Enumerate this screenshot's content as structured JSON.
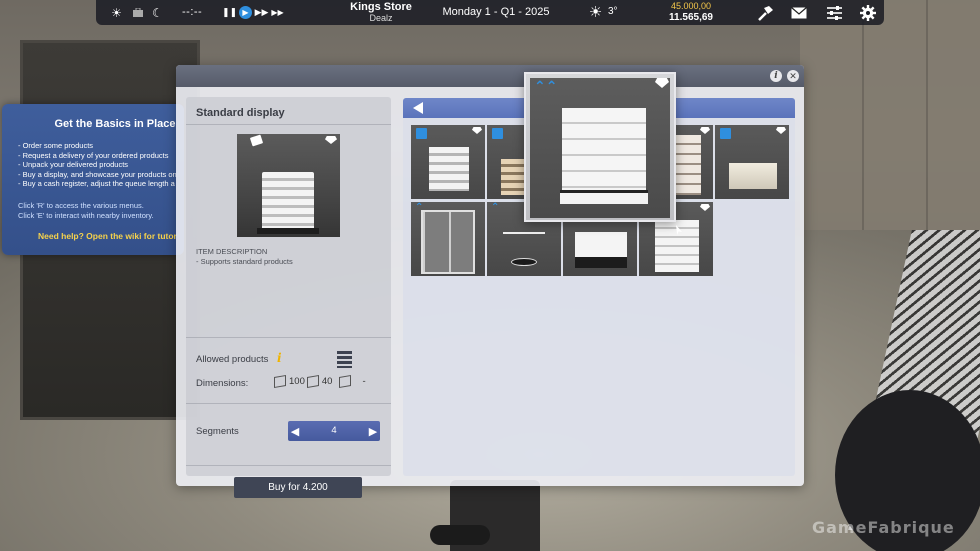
{
  "hud": {
    "clock": "--:--",
    "store_name": "Kings Store",
    "company": "Dealz",
    "date": "Monday 1 - Q1 - 2025",
    "temperature": "3°",
    "credit_limit": "45.000,00",
    "balance": "11.565,69",
    "icons": [
      "sun-icon",
      "briefcase-icon",
      "moon-icon",
      "pause-icon",
      "play-icon",
      "fast-forward-icon",
      "fastest-forward-icon",
      "sunny-weather-icon",
      "hammer-icon",
      "mail-icon",
      "settings-sliders-icon",
      "gear-icon"
    ],
    "accent_color": "#2f8fdf"
  },
  "tutorial": {
    "title": "Get the Basics in Place",
    "steps": [
      "- Order some products",
      "- Request a delivery of your ordered products",
      "- Unpack your delivered products",
      "- Buy a display, and showcase your products on",
      "- Buy a cash register, adjust the queue length a"
    ],
    "hints": [
      "Click 'R' to access the various menus.",
      "Click 'E' to interact with nearby inventory."
    ],
    "help": "Need help? Open the wiki for tutor"
  },
  "item": {
    "name": "Standard display",
    "description_heading": "ITEM DESCRIPTION",
    "description": "- Supports standard products",
    "allowed_products_label": "Allowed products",
    "dimensions_label": "Dimensions:",
    "dim_width": "100",
    "dim_depth": "40",
    "dim_height": "-",
    "segments_label": "Segments",
    "segments_value": "4",
    "buy_label": "Buy for 4.200"
  },
  "catalog": {
    "tiles": [
      {
        "id": "standard-display",
        "badge": "box"
      },
      {
        "id": "wooden-shelf",
        "badge": "box"
      },
      {
        "id": "tall-cabinet",
        "badge": "hanger"
      },
      {
        "id": "fridge-display",
        "badge": "box"
      },
      {
        "id": "chest-freezer",
        "badge": "box"
      },
      {
        "id": "glass-cabinet",
        "badge": "hanger"
      },
      {
        "id": "clothes-rack",
        "badge": "hanger"
      },
      {
        "id": "low-display",
        "badge": "none"
      },
      {
        "id": "corner-display",
        "badge": "none"
      }
    ]
  },
  "watermark": "GameFabrique"
}
